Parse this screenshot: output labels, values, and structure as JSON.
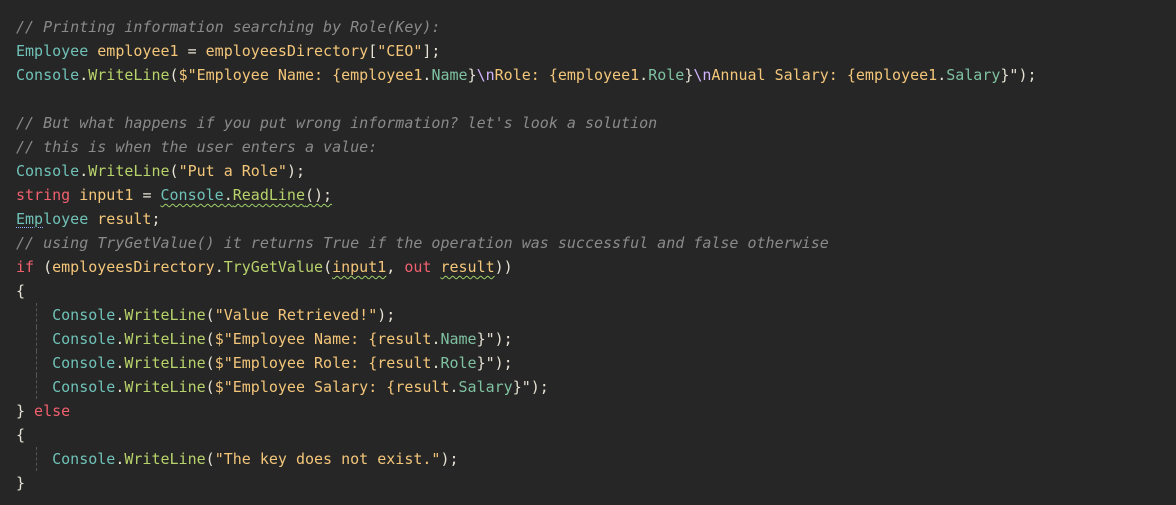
{
  "editor": {
    "lines": [
      {
        "parts": [
          {
            "t": "// Printing information searching by Role(Key):",
            "c": "cmt"
          }
        ]
      },
      {
        "parts": [
          {
            "t": "Employee",
            "c": "typ"
          },
          {
            "t": " employee1 ",
            "c": "var"
          },
          {
            "t": "=",
            "c": "pun"
          },
          {
            "t": " employeesDirectory",
            "c": "var"
          },
          {
            "t": "[",
            "c": "pun"
          },
          {
            "t": "\"CEO\"",
            "c": "str"
          },
          {
            "t": "];",
            "c": "pun"
          }
        ]
      },
      {
        "parts": [
          {
            "t": "Console",
            "c": "typ"
          },
          {
            "t": ".",
            "c": "pun"
          },
          {
            "t": "WriteLine",
            "c": "mth"
          },
          {
            "t": "(",
            "c": "pun"
          },
          {
            "t": "$\"Employee Name: {",
            "c": "str"
          },
          {
            "t": "employee1",
            "c": "var"
          },
          {
            "t": ".",
            "c": "pun"
          },
          {
            "t": "Name",
            "c": "prop"
          },
          {
            "t": "}",
            "c": "pun"
          },
          {
            "t": "\\n",
            "c": "esc"
          },
          {
            "t": "Role: {",
            "c": "str"
          },
          {
            "t": "employee1",
            "c": "var"
          },
          {
            "t": ".",
            "c": "pun"
          },
          {
            "t": "Role",
            "c": "prop"
          },
          {
            "t": "}",
            "c": "pun"
          },
          {
            "t": "\\n",
            "c": "esc"
          },
          {
            "t": "Annual Salary: {",
            "c": "str"
          },
          {
            "t": "employee1",
            "c": "var"
          },
          {
            "t": ".",
            "c": "pun"
          },
          {
            "t": "Salary",
            "c": "prop"
          },
          {
            "t": "}\");",
            "c": "pun"
          }
        ]
      },
      {
        "parts": [
          {
            "t": "",
            "c": "txt"
          }
        ]
      },
      {
        "parts": [
          {
            "t": "// But what happens if you put wrong information? let's look a solution",
            "c": "cmt"
          }
        ]
      },
      {
        "parts": [
          {
            "t": "// this is when the user enters a value:",
            "c": "cmt"
          }
        ]
      },
      {
        "parts": [
          {
            "t": "Console",
            "c": "typ"
          },
          {
            "t": ".",
            "c": "pun"
          },
          {
            "t": "WriteLine",
            "c": "mth"
          },
          {
            "t": "(",
            "c": "pun"
          },
          {
            "t": "\"Put a Role\"",
            "c": "str"
          },
          {
            "t": ");",
            "c": "pun"
          }
        ]
      },
      {
        "parts": [
          {
            "t": "string",
            "c": "kw"
          },
          {
            "t": " input1 ",
            "c": "var"
          },
          {
            "t": "= ",
            "c": "pun"
          },
          {
            "t": "Console",
            "c": "typ ul"
          },
          {
            "t": ".",
            "c": "pun ul"
          },
          {
            "t": "ReadLine",
            "c": "mth ul"
          },
          {
            "t": "();",
            "c": "pun ul"
          }
        ]
      },
      {
        "parts": [
          {
            "t": "Emp",
            "c": "typ ul-dot"
          },
          {
            "t": "loyee",
            "c": "typ"
          },
          {
            "t": " result",
            "c": "var"
          },
          {
            "t": ";",
            "c": "pun"
          }
        ]
      },
      {
        "parts": [
          {
            "t": "// using TryGetValue() it returns True if the operation was successful and false otherwise",
            "c": "cmt"
          }
        ]
      },
      {
        "parts": [
          {
            "t": "if",
            "c": "kw"
          },
          {
            "t": " (",
            "c": "pun"
          },
          {
            "t": "employeesDirectory",
            "c": "var"
          },
          {
            "t": ".",
            "c": "pun"
          },
          {
            "t": "TryGetValue",
            "c": "mth"
          },
          {
            "t": "(",
            "c": "pun"
          },
          {
            "t": "input1",
            "c": "var ul"
          },
          {
            "t": ", ",
            "c": "pun"
          },
          {
            "t": "out",
            "c": "kw"
          },
          {
            "t": " ",
            "c": "pun"
          },
          {
            "t": "result",
            "c": "var ul"
          },
          {
            "t": "))",
            "c": "pun"
          }
        ]
      },
      {
        "parts": [
          {
            "t": "{",
            "c": "pun"
          }
        ]
      },
      {
        "indent": true,
        "parts": [
          {
            "t": "    Console",
            "c": "typ"
          },
          {
            "t": ".",
            "c": "pun"
          },
          {
            "t": "WriteLine",
            "c": "mth"
          },
          {
            "t": "(",
            "c": "pun"
          },
          {
            "t": "\"Value Retrieved!\"",
            "c": "str"
          },
          {
            "t": ");",
            "c": "pun"
          }
        ]
      },
      {
        "indent": true,
        "parts": [
          {
            "t": "    Console",
            "c": "typ"
          },
          {
            "t": ".",
            "c": "pun"
          },
          {
            "t": "WriteLine",
            "c": "mth"
          },
          {
            "t": "(",
            "c": "pun"
          },
          {
            "t": "$\"Employee Name: {",
            "c": "str"
          },
          {
            "t": "result",
            "c": "var"
          },
          {
            "t": ".",
            "c": "pun"
          },
          {
            "t": "Name",
            "c": "prop"
          },
          {
            "t": "}\");",
            "c": "pun"
          }
        ]
      },
      {
        "indent": true,
        "parts": [
          {
            "t": "    Console",
            "c": "typ"
          },
          {
            "t": ".",
            "c": "pun"
          },
          {
            "t": "WriteLine",
            "c": "mth"
          },
          {
            "t": "(",
            "c": "pun"
          },
          {
            "t": "$\"Employee Role: {",
            "c": "str"
          },
          {
            "t": "result",
            "c": "var"
          },
          {
            "t": ".",
            "c": "pun"
          },
          {
            "t": "Role",
            "c": "prop"
          },
          {
            "t": "}\");",
            "c": "pun"
          }
        ]
      },
      {
        "indent": true,
        "parts": [
          {
            "t": "    Console",
            "c": "typ"
          },
          {
            "t": ".",
            "c": "pun"
          },
          {
            "t": "WriteLine",
            "c": "mth"
          },
          {
            "t": "(",
            "c": "pun"
          },
          {
            "t": "$\"Employee Salary: {",
            "c": "str"
          },
          {
            "t": "result",
            "c": "var"
          },
          {
            "t": ".",
            "c": "pun"
          },
          {
            "t": "Salary",
            "c": "prop"
          },
          {
            "t": "}\");",
            "c": "pun"
          }
        ]
      },
      {
        "parts": [
          {
            "t": "}",
            "c": "pun"
          },
          {
            "t": " else",
            "c": "kw"
          }
        ]
      },
      {
        "parts": [
          {
            "t": "{",
            "c": "pun"
          }
        ]
      },
      {
        "indent": true,
        "parts": [
          {
            "t": "    Console",
            "c": "typ"
          },
          {
            "t": ".",
            "c": "pun"
          },
          {
            "t": "WriteLine",
            "c": "mth"
          },
          {
            "t": "(",
            "c": "pun"
          },
          {
            "t": "\"The key does not exist.\"",
            "c": "str"
          },
          {
            "t": ");",
            "c": "pun"
          }
        ]
      },
      {
        "parts": [
          {
            "t": "}",
            "c": "pun"
          }
        ]
      }
    ]
  }
}
